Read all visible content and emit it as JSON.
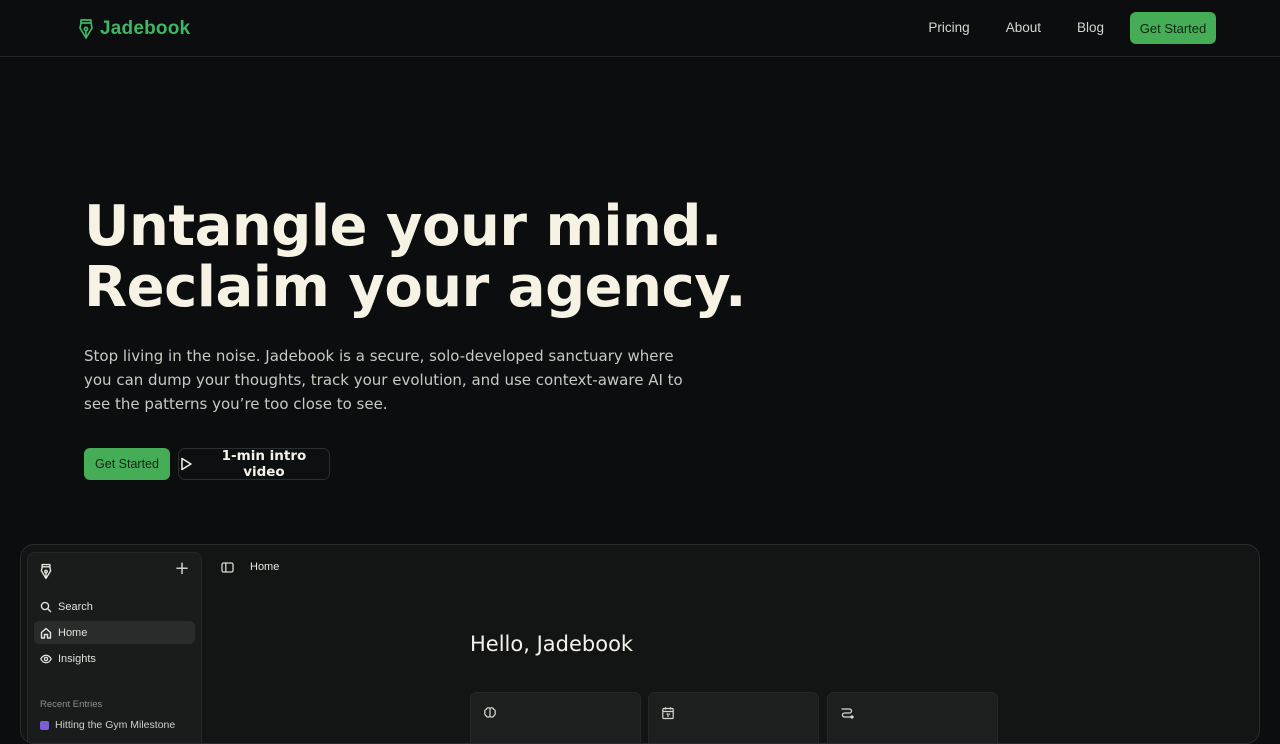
{
  "brand": {
    "name": "Jadebook",
    "color": "#3fb565"
  },
  "nav": {
    "links": [
      "Pricing",
      "About",
      "Blog"
    ],
    "cta": "Get Started"
  },
  "hero": {
    "title_line1": "Untangle your mind.",
    "title_line2": "Reclaim your agency.",
    "subtitle": "Stop living in the noise. Jadebook is a secure, solo-developed sanctuary where you can dump your thoughts, track your evolution, and use context-aware AI to see the patterns you’re too close to see.",
    "primary_cta": "Get Started",
    "video_cta": "1-min intro video"
  },
  "app_preview": {
    "sidebar": {
      "items": [
        {
          "label": "Search",
          "icon": "search-icon"
        },
        {
          "label": "Home",
          "icon": "home-icon",
          "active": true
        },
        {
          "label": "Insights",
          "icon": "eye-icon"
        }
      ],
      "section_title": "Recent Entries",
      "recent_entry": "Hitting the Gym Milestone"
    },
    "breadcrumb": "Home",
    "greeting": "Hello, Jadebook",
    "cards": [
      {
        "icon": "brain-icon"
      },
      {
        "icon": "calendar-icon"
      },
      {
        "icon": "route-icon"
      }
    ]
  },
  "colors": {
    "accent": "#46ad57",
    "background": "#0b0d0e",
    "text": "#f6f3e4"
  }
}
